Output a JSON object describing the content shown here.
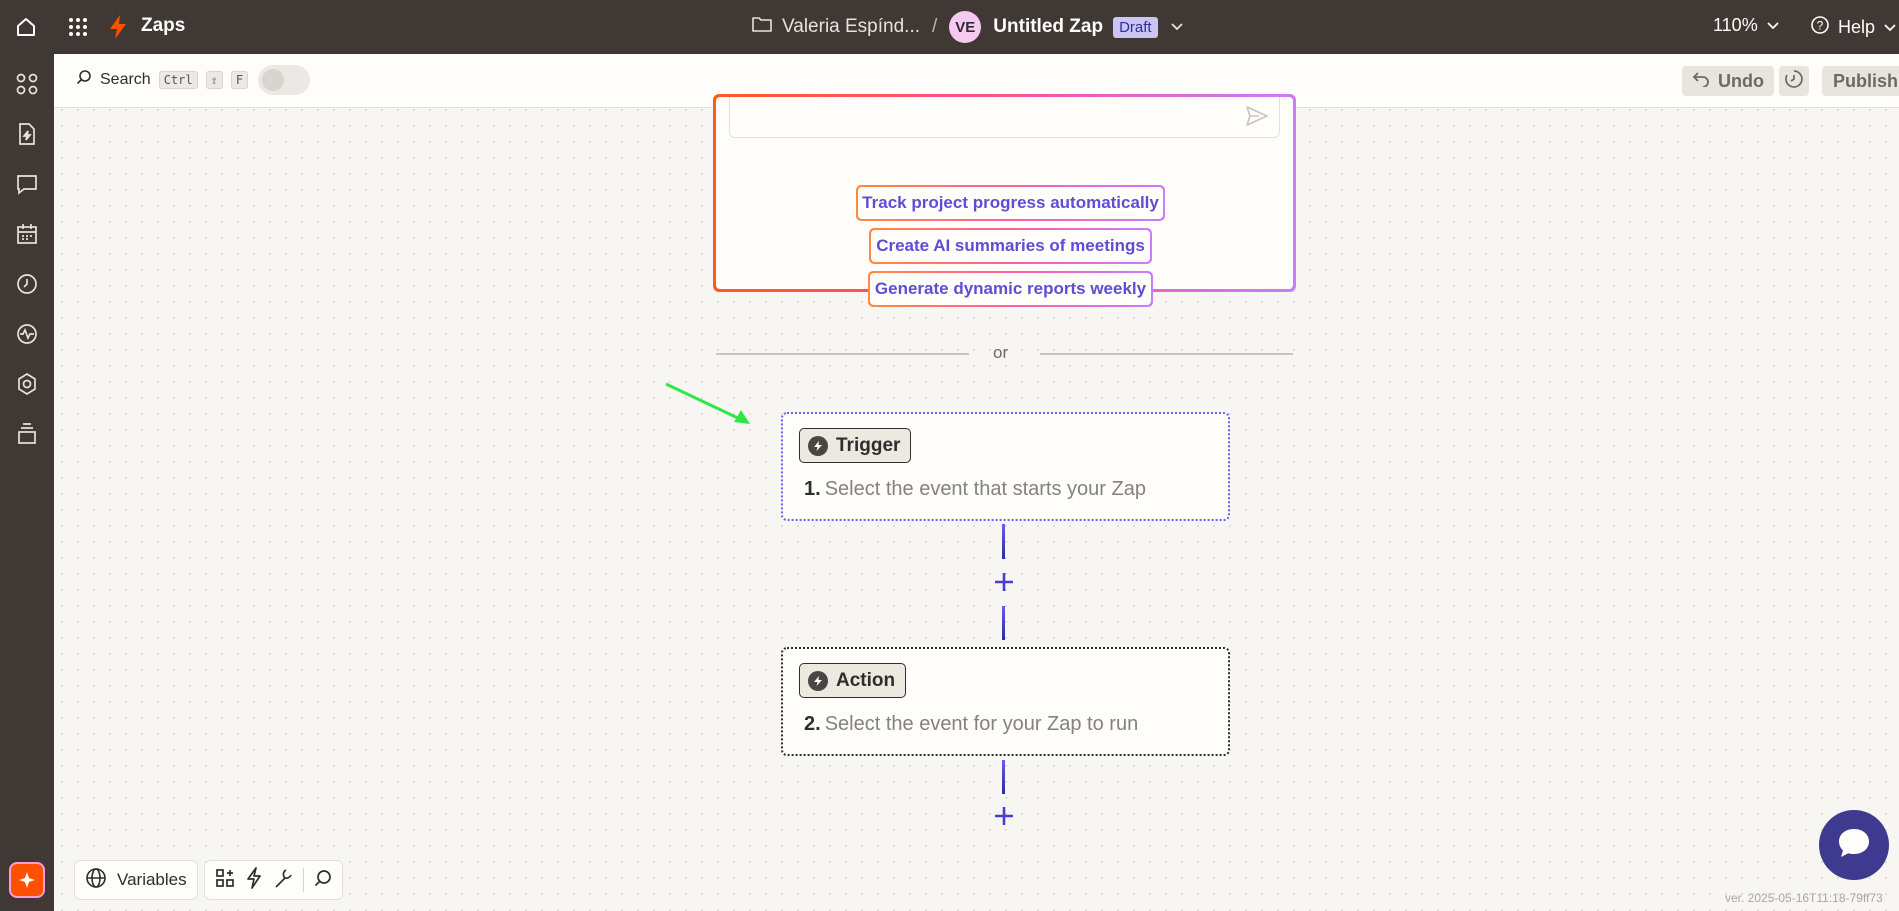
{
  "topbar": {
    "home_icon": "home-icon",
    "apps_icon": "grid-icon",
    "app_icon": "bolt-icon",
    "app_name": "Zaps",
    "folder_name": "Valeria Espínd...",
    "separator": "/",
    "avatar_initials": "VE",
    "zap_name": "Untitled Zap",
    "status_badge": "Draft",
    "zoom": "110%",
    "help_label": "Help"
  },
  "sidebar": {
    "items": [
      {
        "icon": "apps-icon"
      },
      {
        "icon": "document-bolt-icon"
      },
      {
        "icon": "chat-icon"
      },
      {
        "icon": "calendar-icon"
      },
      {
        "icon": "history-icon"
      },
      {
        "icon": "activity-icon"
      },
      {
        "icon": "settings-icon"
      },
      {
        "icon": "layers-icon"
      }
    ],
    "copilot_icon": "sparkle-icon"
  },
  "toolbar": {
    "search_label": "Search",
    "shortcut_keys": [
      "Ctrl",
      "⇧",
      "F"
    ],
    "undo_label": "Undo",
    "publish_label": "Publish"
  },
  "ai_prompt": {
    "suggestions": [
      "Track project progress automatically",
      "Create AI summaries of meetings",
      "Generate dynamic reports weekly"
    ]
  },
  "divider_text": "or",
  "steps": [
    {
      "badge": "Trigger",
      "number": "1.",
      "description": "Select the event that starts your Zap"
    },
    {
      "badge": "Action",
      "number": "2.",
      "description": "Select the event for your Zap to run"
    }
  ],
  "bottom_tools": {
    "variables_label": "Variables"
  },
  "version_text": "ver. 2025-05-16T11:18-79ff73",
  "colors": {
    "chrome": "#403835",
    "accent_purple": "#6a5cf0",
    "brand_orange": "#ff4f00",
    "chat_button": "#3d3a8f"
  }
}
